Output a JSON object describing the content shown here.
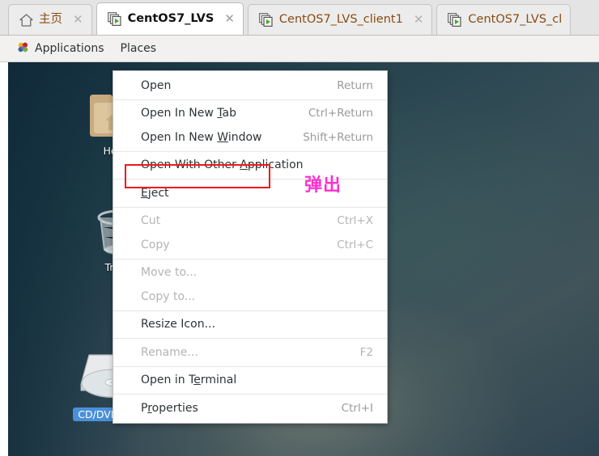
{
  "tabbar": {
    "tabs": [
      {
        "label": "主页",
        "icon": "home-icon",
        "active": false,
        "close_label": "✕"
      },
      {
        "label": "CentOS7_LVS",
        "icon": "virtual-machine-icon",
        "active": true,
        "close_label": "✕"
      },
      {
        "label": "CentOS7_LVS_client1",
        "icon": "virtual-machine-icon",
        "active": false,
        "close_label": "✕"
      },
      {
        "label": "CentOS7_LVS_cl",
        "icon": "virtual-machine-icon",
        "active": false,
        "close_label": ""
      }
    ]
  },
  "gnome_panel": {
    "applications_label": "Applications",
    "places_label": "Places",
    "applications_icon": "gnome-foot-icon"
  },
  "desktop": {
    "background_color": "#2d4450",
    "icons": [
      {
        "name": "home-folder",
        "label": "Home",
        "glyph": "folder-home-icon",
        "selected": false
      },
      {
        "name": "trash",
        "label": "Trash",
        "glyph": "trash-can-icon",
        "selected": false
      },
      {
        "name": "cd-dvd-drive",
        "label": "CD/DVD Drive",
        "glyph": "optical-drive-icon",
        "selected": true
      }
    ]
  },
  "context_menu": {
    "items": [
      {
        "label": "Open",
        "mnemonic": "",
        "accel": "Return",
        "disabled": false,
        "sep_after": true
      },
      {
        "label": "Open In New Tab",
        "mnemonic": "T",
        "accel": "Ctrl+Return",
        "disabled": false,
        "sep_after": false
      },
      {
        "label": "Open In New Window",
        "mnemonic": "W",
        "accel": "Shift+Return",
        "disabled": false,
        "sep_after": true
      },
      {
        "label": "Open With Other Application",
        "mnemonic": "A",
        "accel": "",
        "disabled": false,
        "sep_after": true
      },
      {
        "label": "Eject",
        "mnemonic": "E",
        "accel": "",
        "disabled": false,
        "sep_after": true
      },
      {
        "label": "Cut",
        "mnemonic": "",
        "accel": "Ctrl+X",
        "disabled": true,
        "sep_after": false
      },
      {
        "label": "Copy",
        "mnemonic": "",
        "accel": "Ctrl+C",
        "disabled": true,
        "sep_after": true
      },
      {
        "label": "Move to...",
        "mnemonic": "",
        "accel": "",
        "disabled": true,
        "sep_after": false
      },
      {
        "label": "Copy to...",
        "mnemonic": "",
        "accel": "",
        "disabled": true,
        "sep_after": true
      },
      {
        "label": "Resize Icon...",
        "mnemonic": "",
        "accel": "",
        "disabled": false,
        "sep_after": true
      },
      {
        "label": "Rename...",
        "mnemonic": "",
        "accel": "F2",
        "disabled": true,
        "sep_after": true
      },
      {
        "label": "Open in Terminal",
        "mnemonic": "e",
        "accel": "",
        "disabled": false,
        "sep_after": true
      },
      {
        "label": "Properties",
        "mnemonic": "r",
        "accel": "Ctrl+I",
        "disabled": false,
        "sep_after": false
      }
    ]
  },
  "annotations": {
    "highlight_color": "#f01818",
    "highlight_target": "Eject",
    "note_text": "弹出",
    "note_color": "#ff2fd0"
  }
}
